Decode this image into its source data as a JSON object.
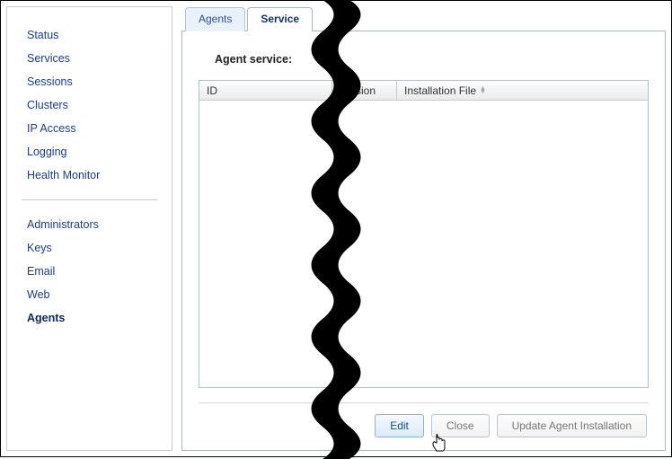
{
  "sidebar": {
    "group1": [
      {
        "label": "Status"
      },
      {
        "label": "Services"
      },
      {
        "label": "Sessions"
      },
      {
        "label": "Clusters"
      },
      {
        "label": "IP Access"
      },
      {
        "label": "Logging"
      },
      {
        "label": "Health Monitor"
      }
    ],
    "group2": [
      {
        "label": "Administrators"
      },
      {
        "label": "Keys"
      },
      {
        "label": "Email"
      },
      {
        "label": "Web"
      },
      {
        "label": "Agents",
        "active": true
      }
    ]
  },
  "tabs": [
    {
      "label": "Agents",
      "active": false
    },
    {
      "label": "Service",
      "active": true
    }
  ],
  "section_title": "Agent service:",
  "table": {
    "columns": {
      "id": "ID",
      "version_fragment": "Version",
      "installation_file": "Installation File"
    },
    "rows": []
  },
  "buttons": {
    "edit": "Edit",
    "close": "Close",
    "update": "Update Agent Installation"
  }
}
